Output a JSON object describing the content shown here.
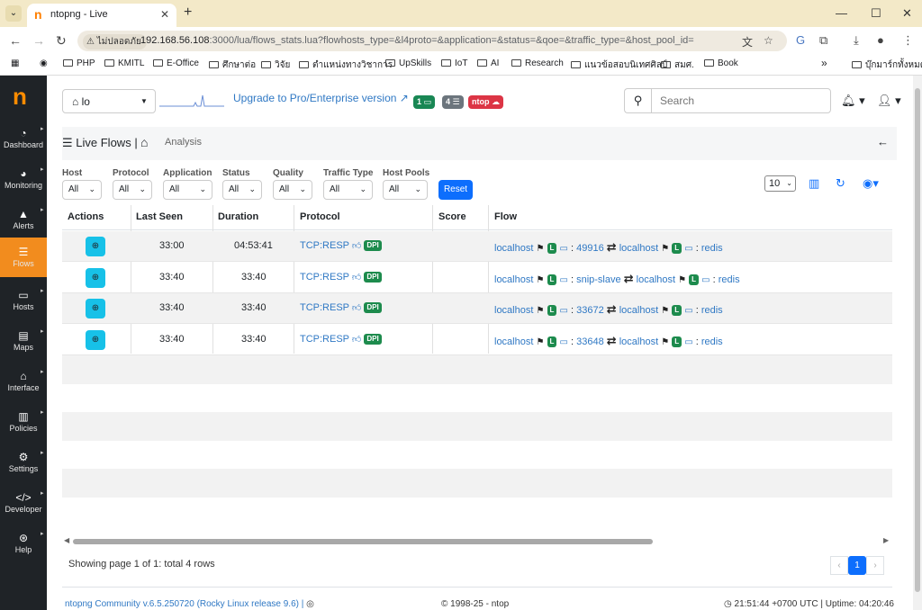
{
  "browser": {
    "tab_title": "ntopng - Live",
    "security_label": "ไม่ปลอดภัย",
    "url_host": "192.168.56.108",
    "url_path": ":3000/lua/flows_stats.lua?flowhosts_type=&l4proto=&application=&status=&qoe=&traffic_type=&host_pool_id=",
    "bookmarks": [
      "PHP",
      "KMITL",
      "E-Office",
      "ศึกษาต่อ",
      "วิจัย",
      "ตำแหน่งทางวิชาการ",
      "UpSkills",
      "IoT",
      "AI",
      "Research",
      "แนวข้อสอบนิเทศศิลป์",
      "สมศ.",
      "Book"
    ],
    "bookmarks_more": "»",
    "bookmarks_all": "บุ๊กมาร์กทั้งหมด"
  },
  "sidebar": {
    "logo": "n",
    "items": [
      {
        "label": "Dashboard",
        "icon": "gauge-icon"
      },
      {
        "label": "Monitoring",
        "icon": "monitoring-icon"
      },
      {
        "label": "Alerts",
        "icon": "alert-triangle-icon"
      },
      {
        "label": "Flows",
        "icon": "list-icon"
      },
      {
        "label": "Hosts",
        "icon": "laptop-icon"
      },
      {
        "label": "Maps",
        "icon": "map-icon"
      },
      {
        "label": "Interface",
        "icon": "ethernet-icon"
      },
      {
        "label": "Policies",
        "icon": "book-icon"
      },
      {
        "label": "Settings",
        "icon": "gear-icon"
      },
      {
        "label": "Developer",
        "icon": "code-icon"
      },
      {
        "label": "Help",
        "icon": "lifebuoy-icon"
      }
    ],
    "active": "Flows"
  },
  "header": {
    "interface": "lo",
    "upgrade": "Upgrade to Pro/Enterprise version",
    "badges": [
      "1",
      "4",
      "ntop"
    ],
    "search_placeholder": "Search"
  },
  "breadcrumb": {
    "title": "Live Flows",
    "sep": "|",
    "analysis": "Analysis"
  },
  "filters": [
    {
      "label": "Host",
      "value": "All"
    },
    {
      "label": "Protocol",
      "value": "All"
    },
    {
      "label": "Application",
      "value": "All"
    },
    {
      "label": "Status",
      "value": "All"
    },
    {
      "label": "Quality",
      "value": "All"
    },
    {
      "label": "Traffic Type",
      "value": "All"
    },
    {
      "label": "Host Pools",
      "value": "All"
    }
  ],
  "reset_label": "Reset",
  "per_page": "10",
  "table": {
    "columns": [
      "Actions",
      "Last Seen",
      "Duration",
      "Protocol",
      "Score",
      "Flow"
    ],
    "rows": [
      {
        "last_seen": "33:00",
        "duration": "04:53:41",
        "protocol": "TCP:RESP",
        "dpi": "DPI",
        "client": "localhost",
        "port": "49916",
        "server": "localhost",
        "service": "redis"
      },
      {
        "last_seen": "33:40",
        "duration": "33:40",
        "protocol": "TCP:RESP",
        "dpi": "DPI",
        "client": "localhost",
        "port": "snip-slave",
        "server": "localhost",
        "service": "redis"
      },
      {
        "last_seen": "33:40",
        "duration": "33:40",
        "protocol": "TCP:RESP",
        "dpi": "DPI",
        "client": "localhost",
        "port": "33672",
        "server": "localhost",
        "service": "redis"
      },
      {
        "last_seen": "33:40",
        "duration": "33:40",
        "protocol": "TCP:RESP",
        "dpi": "DPI",
        "client": "localhost",
        "port": "33648",
        "server": "localhost",
        "service": "redis"
      }
    ],
    "local_badge": "L"
  },
  "pagination": {
    "info": "Showing page 1 of 1: total 4 rows",
    "current": "1",
    "prev": "‹",
    "next": "›"
  },
  "footer": {
    "version": "ntopng Community v.6.5.250720 (Rocky Linux release 9.6) |",
    "copyright": "© 1998-25 - ntop",
    "status": "21:51:44 +0700 UTC | Uptime: 04:20:46"
  }
}
